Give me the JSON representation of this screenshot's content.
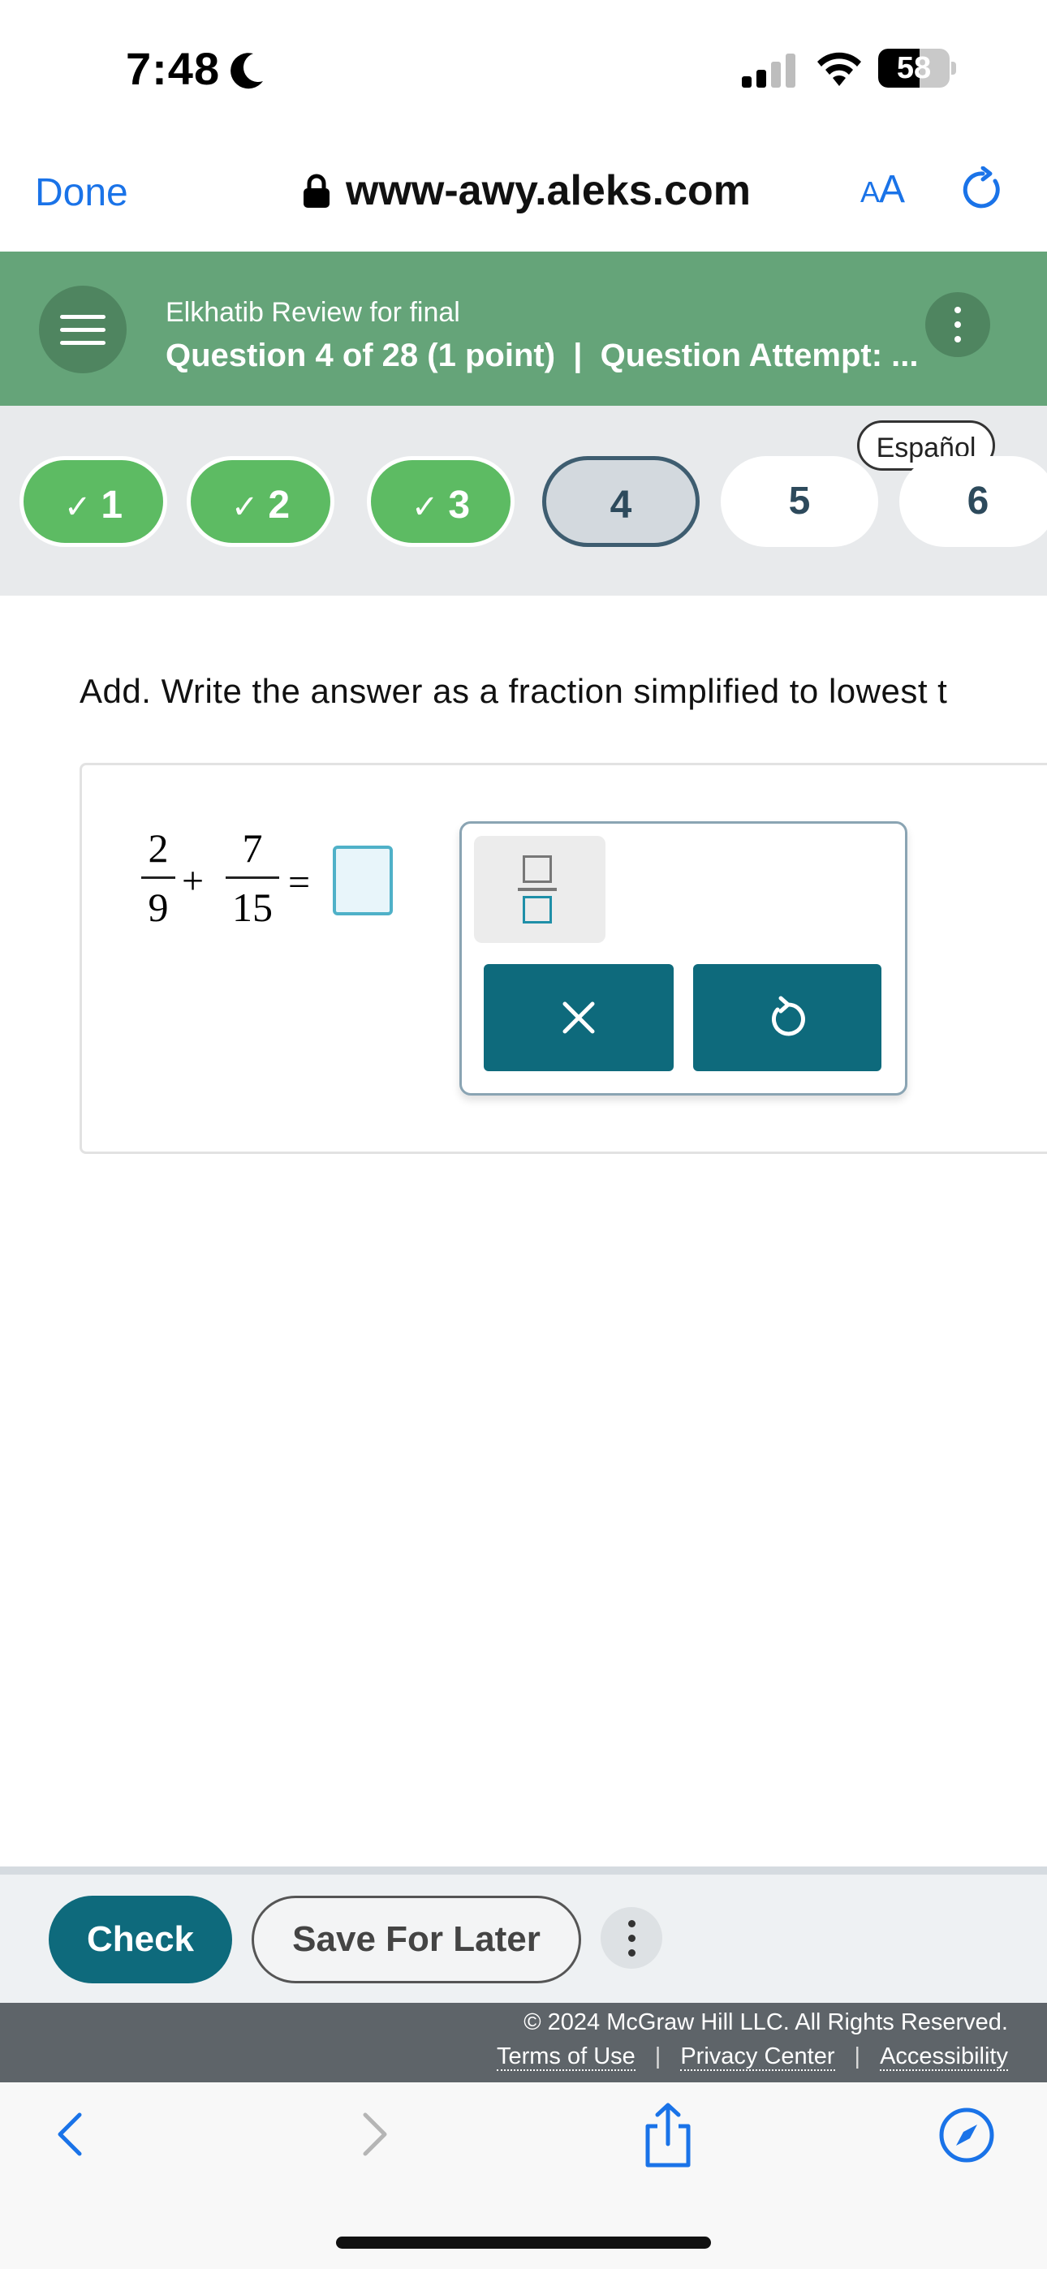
{
  "status_bar": {
    "time": "7:48",
    "battery": "58",
    "battery_level": 0.58
  },
  "browser": {
    "done": "Done",
    "url": "www-awy.aleks.com",
    "text_size_small": "A",
    "text_size_large": "A"
  },
  "header": {
    "course_title": "Elkhatib Review for final",
    "question_info": "Question 4 of 28 (1 point)  |  Question Attempt: ..."
  },
  "language_button": "Español",
  "question_nav": [
    {
      "label": "1",
      "state": "done"
    },
    {
      "label": "2",
      "state": "done"
    },
    {
      "label": "3",
      "state": "done"
    },
    {
      "label": "4",
      "state": "current"
    },
    {
      "label": "5",
      "state": "todo"
    },
    {
      "label": "6",
      "state": "todo"
    }
  ],
  "question": {
    "instruction": "Add. Write the answer as a fraction simplified to lowest t",
    "fraction1": {
      "num": "2",
      "den": "9"
    },
    "operator": "+",
    "fraction2": {
      "num": "7",
      "den": "15"
    },
    "equals": "="
  },
  "palette": {
    "tools": [
      "fraction-template",
      "clear",
      "undo"
    ],
    "clear_symbol": "×"
  },
  "actions": {
    "check": "Check",
    "save_for_later": "Save For Later"
  },
  "footer": {
    "copyright": "© 2024 McGraw Hill LLC. All Rights Reserved.",
    "terms": "Terms of Use",
    "privacy": "Privacy Center",
    "accessibility": "Accessibility"
  },
  "colors": {
    "header_green": "#65a479",
    "done_green": "#5dbb63",
    "teal": "#0e6a7c",
    "link_blue": "#1a73e8"
  }
}
